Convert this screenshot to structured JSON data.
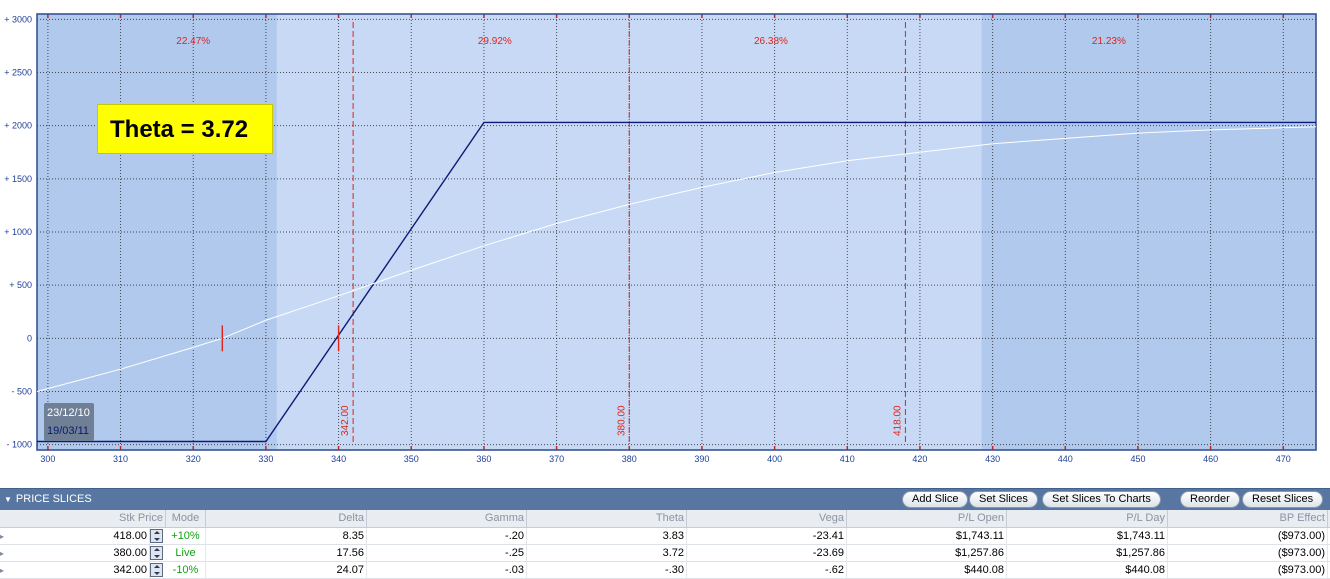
{
  "chart_data": {
    "type": "line",
    "x_ticks": [
      300,
      310,
      320,
      330,
      340,
      350,
      360,
      370,
      380,
      390,
      400,
      410,
      420,
      430,
      440,
      450,
      460,
      470
    ],
    "y_ticks": [
      {
        "value": 3000,
        "label": "+ 3000"
      },
      {
        "value": 2500,
        "label": "+ 2500"
      },
      {
        "value": 2000,
        "label": "+ 2000"
      },
      {
        "value": 1500,
        "label": "+ 1500"
      },
      {
        "value": 1000,
        "label": "+ 1000"
      },
      {
        "value": 500,
        "label": "+ 500"
      },
      {
        "value": 0,
        "label": "0"
      },
      {
        "value": -500,
        "label": "- 500"
      },
      {
        "value": -1000,
        "label": "- 1000"
      }
    ],
    "xlim": [
      298.5,
      474.5
    ],
    "ylim": [
      -1050,
      3050
    ],
    "grid": true,
    "zones": [
      {
        "x0": 298.5,
        "x1": 331.5,
        "label": "22.47%",
        "color": "#b2c9ee"
      },
      {
        "x0": 331.5,
        "x1": 428.5,
        "label": "29.92%",
        "color": "#c7d9f4"
      },
      {
        "x0": 331.5,
        "x1": 428.5,
        "label": "26.38%",
        "color": "#c7d9f4"
      },
      {
        "x0": 428.5,
        "x1": 474.5,
        "label": "21.23%",
        "color": "#b2c9ee"
      }
    ],
    "zone_label_x": [
      320,
      361.5,
      399.5,
      446
    ],
    "price_slices": [
      342,
      380,
      418
    ],
    "price_slice_labels": [
      "342.00",
      "380.00",
      "418.00"
    ],
    "breakeven_marks": [
      324,
      340
    ],
    "series": [
      {
        "name": "19/03/11",
        "color": "#0e1b78",
        "x": [
          298.5,
          330,
          360,
          474.5
        ],
        "y": [
          -970,
          -970,
          2030,
          2030
        ]
      },
      {
        "name": "23/12/10",
        "color": "#ffffff",
        "x": [
          298.5,
          310,
          320,
          324,
          330,
          340,
          350,
          360,
          370,
          380,
          390,
          400,
          410,
          420,
          430,
          440,
          450,
          460,
          474.5
        ],
        "y": [
          -500,
          -290,
          -85,
          0,
          170,
          400,
          640,
          870,
          1080,
          1260,
          1420,
          1560,
          1670,
          1750,
          1830,
          1880,
          1930,
          1960,
          1990
        ]
      }
    ]
  },
  "annotation": {
    "theta_text": "Theta = 3.72"
  },
  "legend": {
    "date1": "23/12/10",
    "date2": "19/03/11"
  },
  "slices_panel": {
    "title": "PRICE SLICES",
    "buttons": [
      "Add Slice",
      "Set Slices",
      "Set Slices To Charts",
      "Reorder",
      "Reset Slices"
    ]
  },
  "table": {
    "columns": [
      "Stk Price",
      "Mode",
      "Delta",
      "Gamma",
      "Theta",
      "Vega",
      "P/L Open",
      "P/L Day",
      "BP Effect"
    ],
    "rows": [
      [
        "418.00",
        "+10%",
        "8.35",
        "-.20",
        "3.83",
        "-23.41",
        "$1,743.11",
        "$1,743.11",
        "($973.00)"
      ],
      [
        "380.00",
        "Live",
        "17.56",
        "-.25",
        "3.72",
        "-23.69",
        "$1,257.86",
        "$1,257.86",
        "($973.00)"
      ],
      [
        "342.00",
        "-10%",
        "24.07",
        "-.03",
        "-.30",
        "-.62",
        "$440.08",
        "$440.08",
        "($973.00)"
      ]
    ]
  }
}
